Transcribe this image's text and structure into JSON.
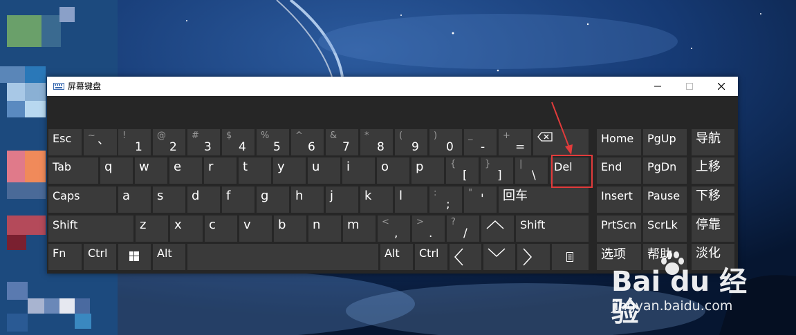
{
  "window": {
    "title": "屏幕键盘",
    "controls": {
      "minimize": "minimize",
      "maximize": "maximize",
      "close": "close"
    }
  },
  "keys": {
    "esc": "Esc",
    "tilde": {
      "top": "~",
      "main": "、"
    },
    "k1": {
      "top": "!",
      "main": "1"
    },
    "k2": {
      "top": "@",
      "main": "2"
    },
    "k3": {
      "top": "#",
      "main": "3"
    },
    "k4": {
      "top": "$",
      "main": "4"
    },
    "k5": {
      "top": "%",
      "main": "5"
    },
    "k6": {
      "top": "^",
      "main": "6"
    },
    "k7": {
      "top": "&",
      "main": "7"
    },
    "k8": {
      "top": "*",
      "main": "8"
    },
    "k9": {
      "top": "(",
      "main": "9"
    },
    "k0": {
      "top": ")",
      "main": "0"
    },
    "minus": {
      "top": "_",
      "main": "-"
    },
    "equals": {
      "top": "+",
      "main": "="
    },
    "tab": "Tab",
    "q": "q",
    "w": "w",
    "e": "e",
    "r": "r",
    "t": "t",
    "y": "y",
    "u": "u",
    "i": "i",
    "o": "o",
    "p": "p",
    "lbracket": {
      "top": "{",
      "main": "["
    },
    "rbracket": {
      "top": "}",
      "main": "]"
    },
    "backslash": {
      "top": "|",
      "main": "\\"
    },
    "del": "Del",
    "caps": "Caps",
    "a": "a",
    "s": "s",
    "d": "d",
    "f": "f",
    "g": "g",
    "h": "h",
    "j": "j",
    "k": "k",
    "l": "l",
    "semicolon": {
      "top": ":",
      "main": ";"
    },
    "quote": {
      "top": "\"",
      "main": "'"
    },
    "enter": "回车",
    "shift_left": "Shift",
    "z": "z",
    "x": "x",
    "c": "c",
    "v": "v",
    "b": "b",
    "n": "n",
    "m": "m",
    "comma": {
      "top": "<",
      "main": ","
    },
    "period": {
      "top": ">",
      "main": "."
    },
    "slash": {
      "top": "?",
      "main": "/"
    },
    "shift_right": "Shift",
    "fn": "Fn",
    "ctrl_left": "Ctrl",
    "alt_left": "Alt",
    "alt_right": "Alt",
    "ctrl_right": "Ctrl",
    "home": "Home",
    "pgup": "PgUp",
    "nav": "导航",
    "end": "End",
    "pgdn": "PgDn",
    "moveup": "上移",
    "insert": "Insert",
    "pause": "Pause",
    "movedown": "下移",
    "prtscn": "PrtScn",
    "scrlk": "ScrLk",
    "dock": "停靠",
    "options": "选项",
    "help": "帮助",
    "fade": "淡化"
  },
  "watermark": {
    "brand": "Bai du 经验",
    "url": "jingyan.baidu.com"
  },
  "colors": {
    "key_bg": "#3a3a3a",
    "window_bg": "#262626",
    "highlight": "#e23b3b"
  }
}
